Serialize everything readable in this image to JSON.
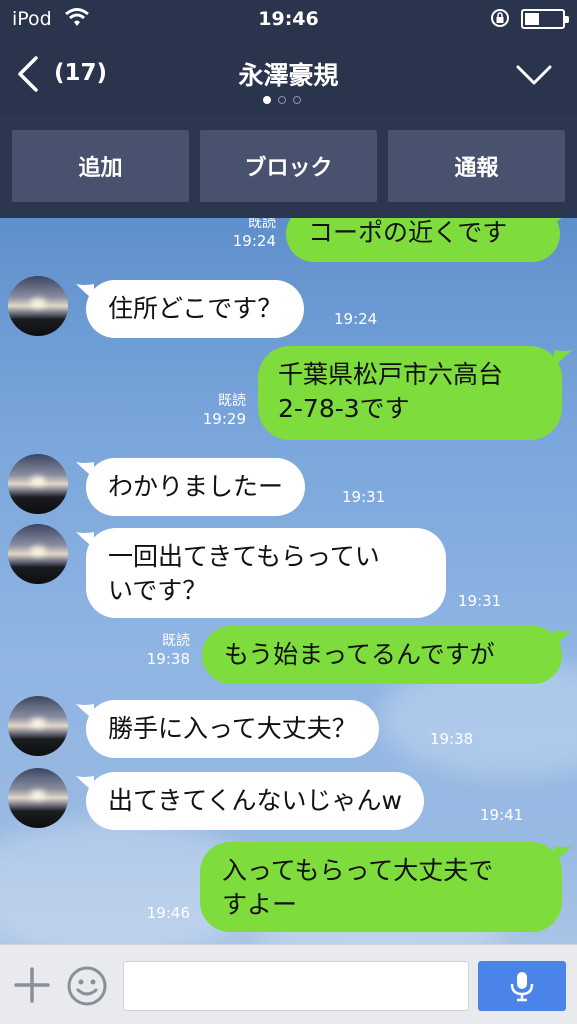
{
  "status": {
    "carrier": "iPod",
    "time": "19:46"
  },
  "header": {
    "back_count": "(17)",
    "title": "永澤豪規",
    "page_dots": 3,
    "active_dot": 1
  },
  "actions": [
    {
      "label": "追加"
    },
    {
      "label": "ブロック"
    },
    {
      "label": "通報"
    }
  ],
  "messages": [
    {
      "side": "out",
      "text": "コーポの近くです",
      "time": "19:24",
      "read": "既読"
    },
    {
      "side": "in",
      "text": "住所どこです？",
      "time": "19:24"
    },
    {
      "side": "out",
      "line1": "千葉県松戸市六高台",
      "line2": "2-78-3です",
      "time": "19:29",
      "read": "既読"
    },
    {
      "side": "in",
      "text": "わかりましたー",
      "time": "19:31"
    },
    {
      "side": "in",
      "line1": "一回出てきてもらってい",
      "line2": "いです？",
      "time": "19:31"
    },
    {
      "side": "out",
      "text": "もう始まってるんですが",
      "time": "19:38",
      "read": "既読"
    },
    {
      "side": "in",
      "text": "勝手に入って大丈夫？",
      "time": "19:38"
    },
    {
      "side": "in",
      "text": "出てきてくんないじゃんw",
      "time": "19:41"
    },
    {
      "side": "out",
      "line1": "入ってもらって大丈夫で",
      "line2": "すよー",
      "time": "19:46"
    }
  ],
  "input": {
    "placeholder": ""
  },
  "colors": {
    "header_bg": "#2a344d",
    "bubble_out": "#7edc3c",
    "bubble_in": "#ffffff",
    "send_button": "#4a84e8"
  }
}
